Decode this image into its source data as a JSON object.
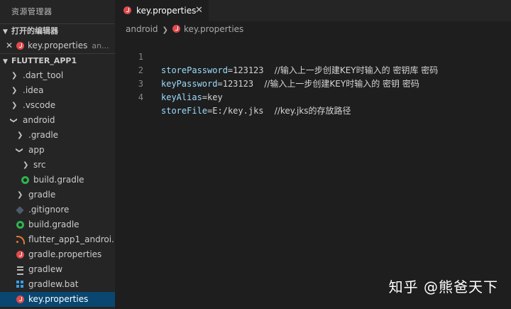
{
  "sidebar": {
    "title": "资源管理器",
    "open_editors": {
      "label": "打开的编辑器",
      "items": [
        {
          "name": "key.properties",
          "desc": "an..."
        }
      ]
    },
    "project": {
      "label": "FLUTTER_APP1",
      "items": [
        {
          "label": ".dart_tool",
          "type": "folder",
          "collapsed": true
        },
        {
          "label": ".idea",
          "type": "folder",
          "collapsed": true
        },
        {
          "label": ".vscode",
          "type": "folder",
          "collapsed": true
        },
        {
          "label": "android",
          "type": "folder",
          "collapsed": false
        },
        {
          "label": ".gradle",
          "type": "folder",
          "collapsed": true
        },
        {
          "label": "app",
          "type": "folder",
          "collapsed": false
        },
        {
          "label": "src",
          "type": "folder",
          "collapsed": true
        },
        {
          "label": "build.gradle",
          "type": "gradle-icon"
        },
        {
          "label": "gradle",
          "type": "folder",
          "collapsed": true
        },
        {
          "label": ".gitignore",
          "type": "git-icon"
        },
        {
          "label": "build.gradle",
          "type": "gradle-icon"
        },
        {
          "label": "flutter_app1_androi...",
          "type": "rss-icon"
        },
        {
          "label": "gradle.properties",
          "type": "properties-icon"
        },
        {
          "label": "gradlew",
          "type": "lines-icon"
        },
        {
          "label": "gradlew.bat",
          "type": "windows-icon"
        },
        {
          "label": "key.properties",
          "type": "properties-icon",
          "selected": true
        }
      ]
    }
  },
  "editor": {
    "tab": {
      "label": "key.properties",
      "close": "✕"
    },
    "breadcrumb": {
      "folder": "android",
      "file": "key.properties"
    },
    "lines": [
      {
        "num": "1",
        "key": "storePassword",
        "eq": "=",
        "value": "123123",
        "comment": "    //输入上一步创建KEY时输入的 密钥库 密码"
      },
      {
        "num": "2",
        "key": "keyPassword",
        "eq": "=",
        "value": "123123",
        "comment": "    //输入上一步创建KEY时输入的 密钥 密码"
      },
      {
        "num": "3",
        "key": "keyAlias",
        "eq": "=",
        "value": "key",
        "comment": ""
      },
      {
        "num": "4",
        "key": "storeFile",
        "eq": "=",
        "value": "E:/key.jks",
        "comment": "    //key.jks的存放路径"
      }
    ]
  },
  "watermark": "知乎 @熊爸天下",
  "colors": {
    "sidebar_bg": "#252526",
    "editor_bg": "#1e1e1e",
    "selection": "#094771",
    "key": "#9cdcfe",
    "properties_icon": "#e04b4b",
    "gradle_icon": "#2fb34f"
  }
}
